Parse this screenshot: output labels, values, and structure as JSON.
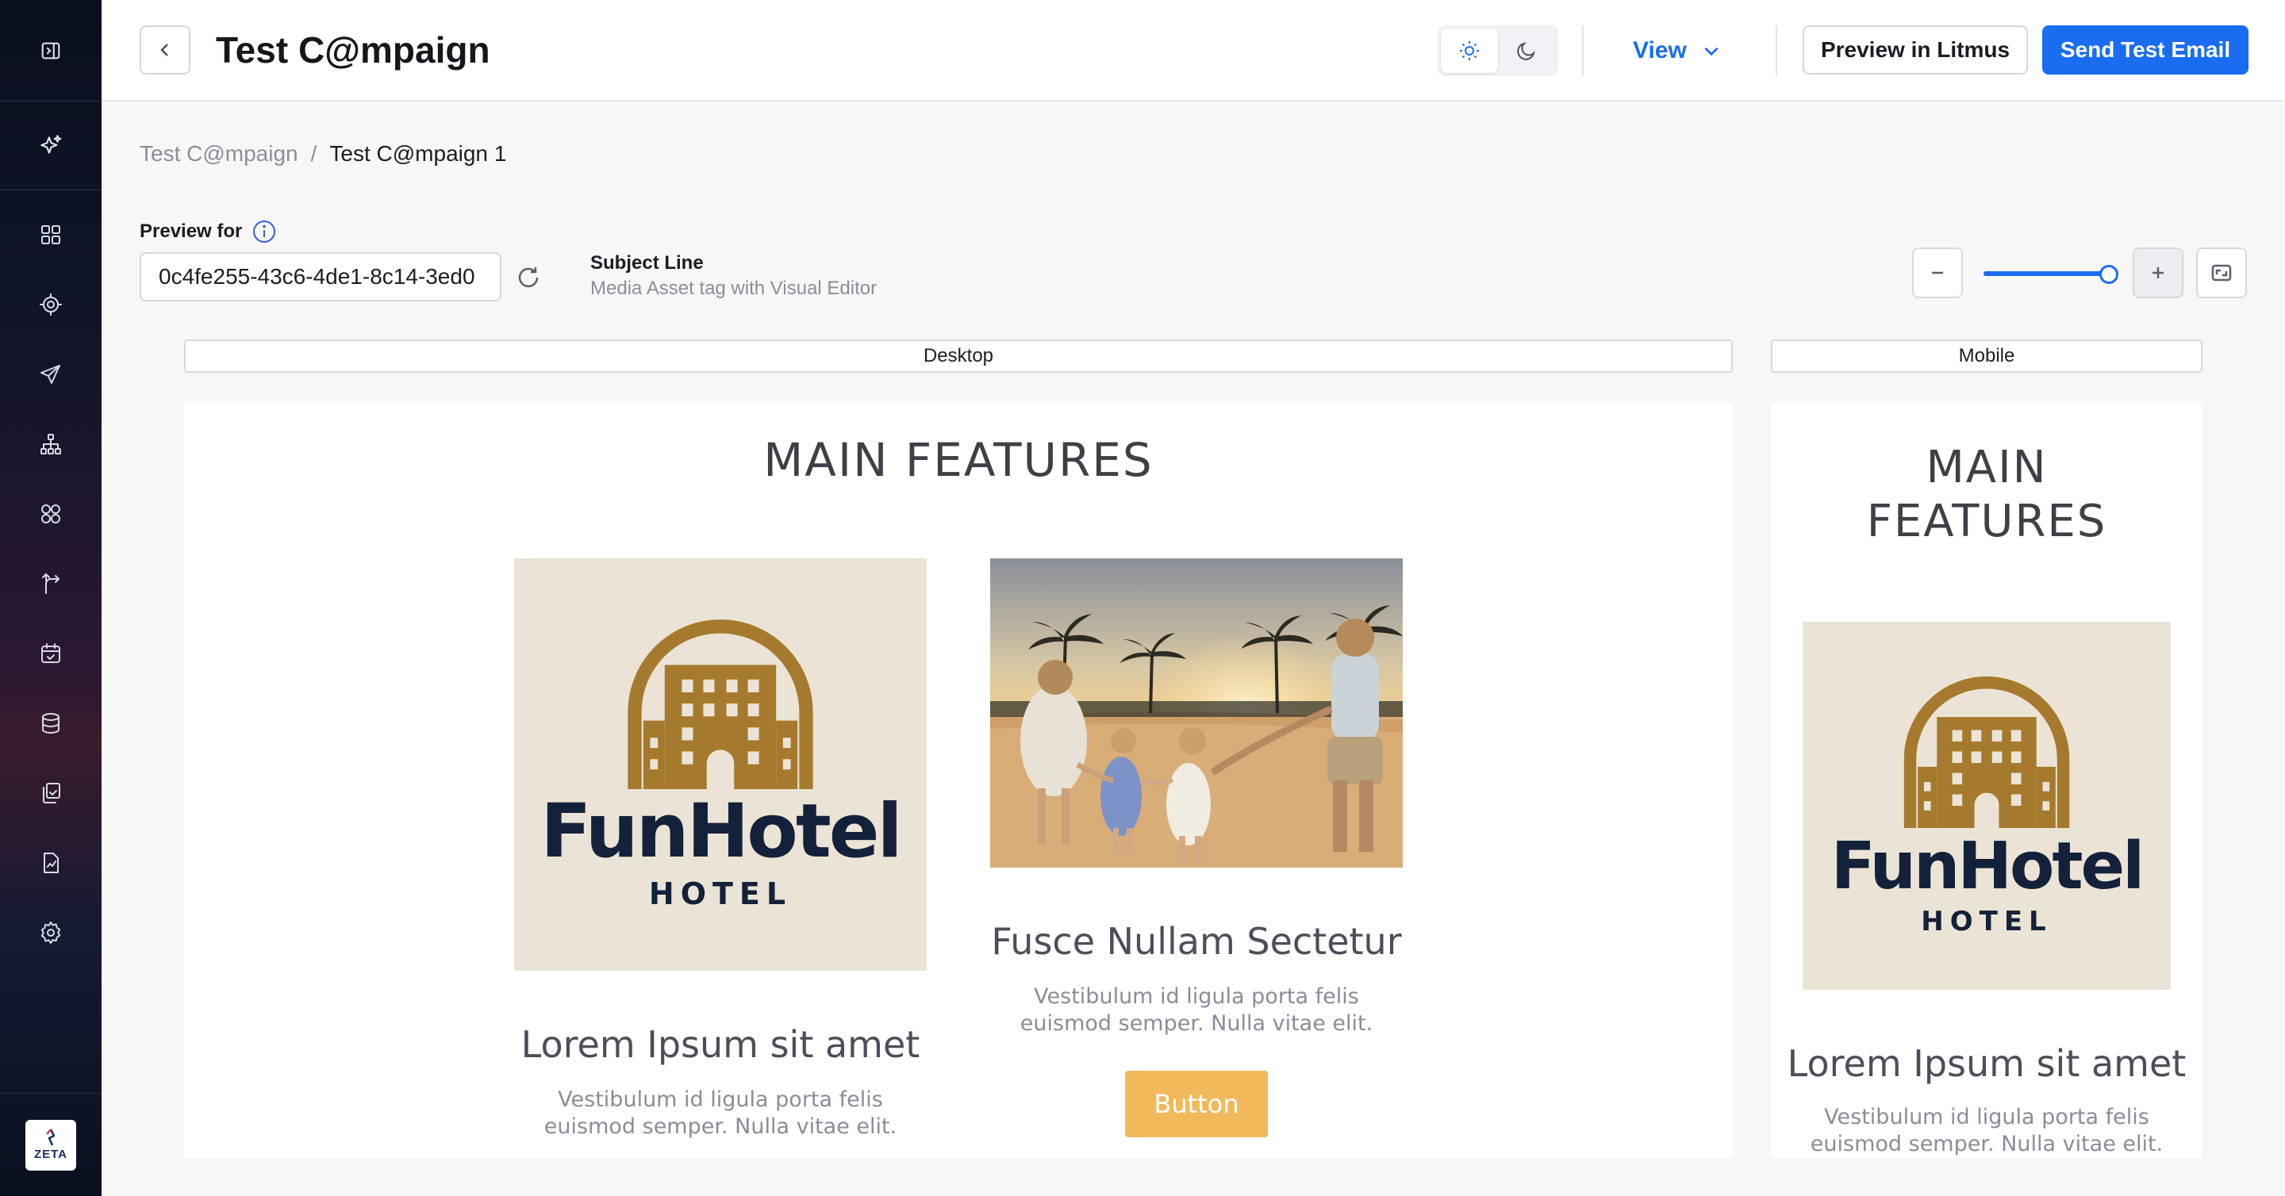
{
  "sidebar": {
    "toggle_icon": "sidebar-toggle-icon",
    "sparkle_icon": "sparkle-icon",
    "items": [
      {
        "icon": "dashboard-icon",
        "name": "sidebar-item-dashboard"
      },
      {
        "icon": "target-icon",
        "name": "sidebar-item-audience"
      },
      {
        "icon": "send-icon",
        "name": "sidebar-item-campaigns"
      },
      {
        "icon": "hierarchy-icon",
        "name": "sidebar-item-journeys"
      },
      {
        "icon": "segments-icon",
        "name": "sidebar-item-segments"
      },
      {
        "icon": "route-icon",
        "name": "sidebar-item-routing"
      },
      {
        "icon": "calendar-icon",
        "name": "sidebar-item-calendar"
      },
      {
        "icon": "database-icon",
        "name": "sidebar-item-data"
      },
      {
        "icon": "copy-icon",
        "name": "sidebar-item-content"
      },
      {
        "icon": "report-icon",
        "name": "sidebar-item-reports"
      },
      {
        "icon": "gear-icon",
        "name": "sidebar-item-settings"
      }
    ],
    "logo_text": "ZETA"
  },
  "header": {
    "title": "Test C@mpaign",
    "view_label": "View",
    "preview_litmus_label": "Preview in Litmus",
    "send_test_label": "Send Test Email"
  },
  "breadcrumb": {
    "parent": "Test C@mpaign",
    "separator": "/",
    "current": "Test C@mpaign 1"
  },
  "preview": {
    "label": "Preview for",
    "value": "0c4fe255-43c6-4de1-8c14-3ed0",
    "subject_label": "Subject Line",
    "subject_value": "Media Asset tag with Visual Editor"
  },
  "zoom": {
    "level": 1.0
  },
  "tabs": {
    "desktop": "Desktop",
    "mobile": "Mobile"
  },
  "email": {
    "title": "MAIN FEATURES",
    "logo_wordmark": "FunHotel",
    "logo_subword": "HOTEL",
    "card1_title": "Lorem Ipsum sit amet",
    "card1_desc": "Vestibulum id ligula porta felis euismod semper. Nulla vitae elit.",
    "card2_title": "Fusce Nullam Sectetur",
    "card2_desc": "Vestibulum id ligula porta felis euismod semper. Nulla vitae elit.",
    "button_label": "Button"
  },
  "colors": {
    "accent": "#1a6df0",
    "email_button": "#f2b95a",
    "logo_gold": "#a57a2e",
    "logo_navy": "#13213a",
    "logo_bg": "#ebe4d6"
  }
}
